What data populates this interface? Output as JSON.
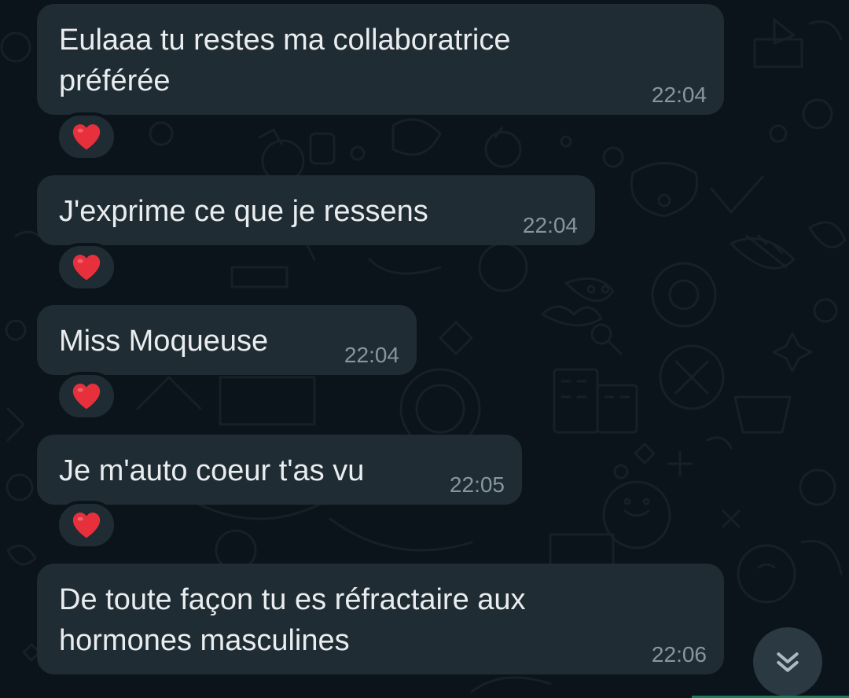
{
  "messages": [
    {
      "lines": [
        "Eulaaa tu restes ma collaboratrice",
        "préférée"
      ],
      "time": "22:04",
      "reaction_icon": "red-heart-icon"
    },
    {
      "lines": [
        "J'exprime ce que je ressens"
      ],
      "time": "22:04",
      "reaction_icon": "red-heart-icon"
    },
    {
      "lines": [
        "Miss Moqueuse"
      ],
      "time": "22:04",
      "reaction_icon": "red-heart-icon"
    },
    {
      "lines": [
        "Je m'auto coeur t'as vu"
      ],
      "time": "22:05",
      "reaction_icon": "red-heart-icon"
    },
    {
      "lines": [
        "De toute façon tu es réfractaire aux",
        "hormones masculines"
      ],
      "time": "22:06"
    }
  ],
  "scroll_button_icon": "double-chevron-down-icon",
  "colors": {
    "background": "#0b141a",
    "bubble": "#202c33",
    "text": "#e9edef",
    "time": "#8696a0",
    "heart": "#e8303d",
    "scroll_button": "#2a3942"
  }
}
